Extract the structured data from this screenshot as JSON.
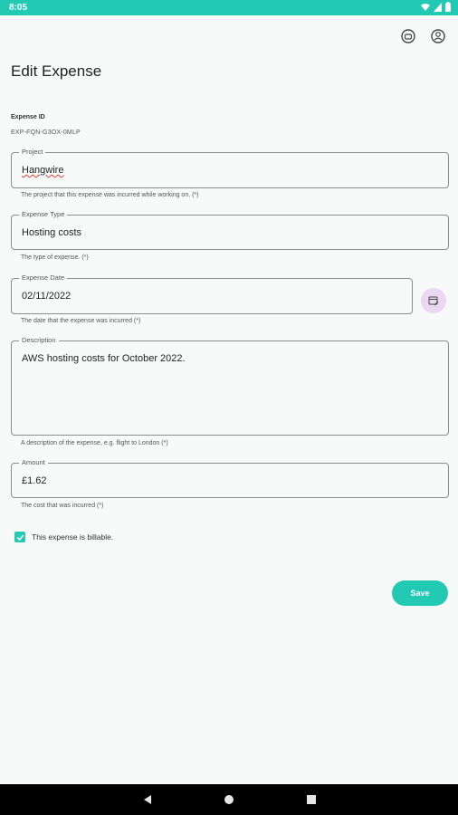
{
  "status_bar": {
    "time": "8:05"
  },
  "header": {
    "title": "Edit Expense",
    "icons": [
      "support-icon",
      "account-icon"
    ]
  },
  "expense_id": {
    "label": "Expense ID",
    "value": "EXP-FQN-G3OX-0MLP"
  },
  "fields": {
    "project": {
      "label": "Project",
      "value": "Hangwire",
      "helper": "The project that this expense was incurred while working on. (*)"
    },
    "expense_type": {
      "label": "Expense Type",
      "value": "Hosting costs",
      "helper": "The type of expense. (*)"
    },
    "expense_date": {
      "label": "Expense Date",
      "value": "02/11/2022",
      "helper": "The date that the expense was incurred (*)"
    },
    "description": {
      "label": "Description",
      "value": "AWS hosting costs for October 2022.",
      "helper": "A description of the expense, e.g. flight to London (*)"
    },
    "amount": {
      "label": "Amount",
      "value": "£1.62",
      "helper": "The cost that was incurred (*)"
    }
  },
  "billable": {
    "checked": true,
    "label": "This expense is billable."
  },
  "actions": {
    "save_label": "Save"
  },
  "colors": {
    "accent": "#22c9b3",
    "calendar_button": "#ead7f2"
  }
}
